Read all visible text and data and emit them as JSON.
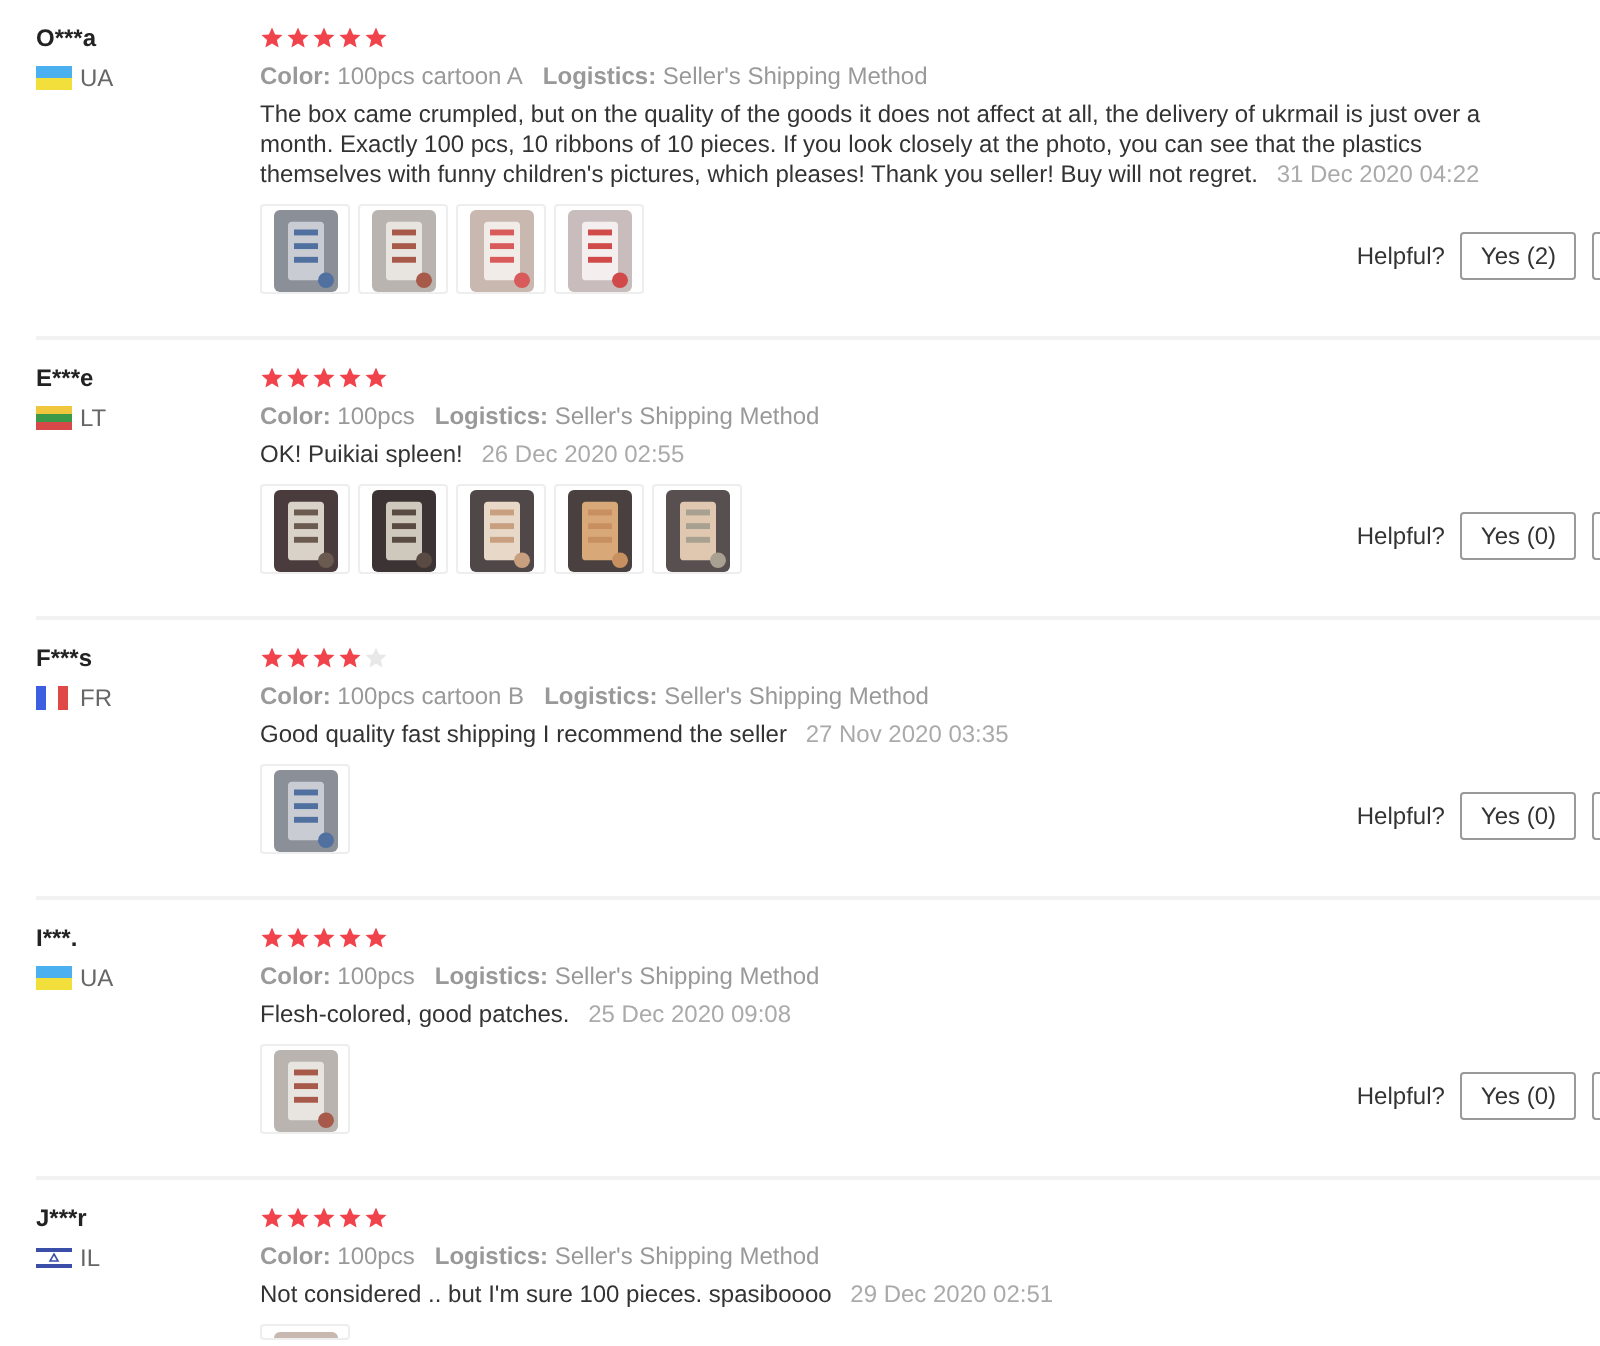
{
  "reviews": [
    {
      "user": "O***a",
      "kind": "ua",
      "country": "UA",
      "stars": 5,
      "color_label": "Color:",
      "variant": "100pcs cartoon A",
      "logistics_label": "Logistics:",
      "logistics": "Seller's Shipping Method",
      "text": "The box came crumpled, but on the quality of the goods it does not affect at all, the delivery of ukrmail is just over a month. Exactly 100 pcs, 10 ribbons of 10 pieces. If you look closely at the photo, you can see that the plastics themselves with funny children's pictures, which pleases! Thank you seller! Buy will not regret.",
      "date": "31 Dec 2020 04:22",
      "photos": [
        {
          "kind": "picture"
        },
        {
          "kind": "picture"
        },
        {
          "kind": "picture"
        },
        {
          "kind": "picture"
        }
      ],
      "helpful": "Helpful?",
      "yes": "Yes (2)"
    },
    {
      "user": "E***e",
      "kind": "lt",
      "country": "LT",
      "stars": 5,
      "color_label": "Color:",
      "variant": "100pcs",
      "logistics_label": "Logistics:",
      "logistics": "Seller's Shipping Method",
      "text": "OK! Puikiai spleen!",
      "date": "26 Dec 2020 02:55",
      "photos": [
        {
          "kind": "picture"
        },
        {
          "kind": "picture"
        },
        {
          "kind": "picture"
        },
        {
          "kind": "picture"
        },
        {
          "kind": "picture"
        }
      ],
      "helpful": "Helpful?",
      "yes": "Yes (0)"
    },
    {
      "user": "F***s",
      "kind": "fr",
      "country": "FR",
      "stars": 4,
      "color_label": "Color:",
      "variant": "100pcs cartoon B",
      "logistics_label": "Logistics:",
      "logistics": "Seller's Shipping Method",
      "text": "Good quality fast shipping I recommend the seller",
      "date": "27 Nov 2020 03:35",
      "photos": [
        {
          "kind": "picture"
        }
      ],
      "helpful": "Helpful?",
      "yes": "Yes (0)"
    },
    {
      "user": "I***.",
      "kind": "ua",
      "country": "UA",
      "stars": 5,
      "color_label": "Color:",
      "variant": "100pcs",
      "logistics_label": "Logistics:",
      "logistics": "Seller's Shipping Method",
      "text": "Flesh-colored, good patches.",
      "date": "25 Dec 2020 09:08",
      "photos": [
        {
          "kind": "picture"
        }
      ],
      "helpful": "Helpful?",
      "yes": "Yes (0)"
    },
    {
      "user": "J***r",
      "kind": "il",
      "country": "IL",
      "stars": 5,
      "color_label": "Color:",
      "variant": "100pcs",
      "logistics_label": "Logistics:",
      "logistics": "Seller's Shipping Method",
      "text": "Not considered .. but I'm sure 100 pieces. spasiboooo",
      "date": "29 Dec 2020 02:51",
      "photos": [
        {
          "kind": "picture"
        }
      ]
    }
  ]
}
